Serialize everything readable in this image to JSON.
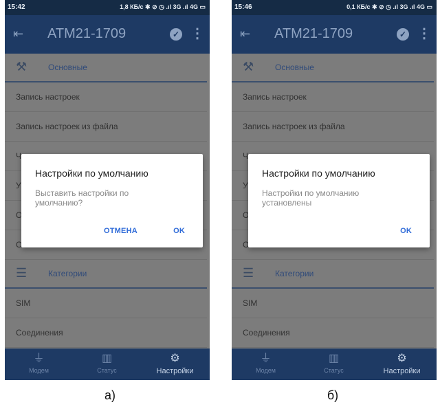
{
  "colors": {
    "statusbar": "#152b45",
    "appbar": "#1e3a64",
    "bottomnav": "#1e3a64",
    "dimmed_background": "#7c7c7c",
    "dialog_button": "#2f6bd8"
  },
  "screens": [
    {
      "caption": "а)",
      "status": {
        "time": "15:42",
        "icons": "1,8 КБ/с ✱ ⊘ ◷ .ıl 3G .ıl 4G ▭"
      },
      "appbar": {
        "title": "ATM21-1709",
        "back_icon": "back-arrow-icon",
        "check_icon": "check-circle-icon",
        "more_icon": "more-vert-icon"
      },
      "sections": [
        {
          "header": "Основные",
          "icon": "tools-icon",
          "items": [
            "Запись настроек",
            "Запись настроек из файла",
            "Чтение настроек",
            "У",
            "О",
            "О"
          ]
        },
        {
          "header": "Категории",
          "icon": "sliders-icon",
          "items": [
            "SIM",
            "Соединения"
          ]
        }
      ],
      "bottom_nav": [
        {
          "label": "Модем",
          "icon": "modem-icon",
          "active": false
        },
        {
          "label": "Статус",
          "icon": "status-icon",
          "active": false
        },
        {
          "label": "Настройки",
          "icon": "gear-icon",
          "active": true
        }
      ],
      "dialog": {
        "title": "Настройки по умолчанию",
        "message": "Выставить настройки по умолчанию?",
        "cancel_label": "ОТМЕНА",
        "ok_label": "OK"
      }
    },
    {
      "caption": "б)",
      "status": {
        "time": "15:46",
        "icons": "0,1 КБ/с ✱ ⊘ ◷ .ıl 3G .ıl 4G ▭"
      },
      "appbar": {
        "title": "ATM21-1709",
        "back_icon": "back-arrow-icon",
        "check_icon": "check-circle-icon",
        "more_icon": "more-vert-icon"
      },
      "sections": [
        {
          "header": "Основные",
          "icon": "tools-icon",
          "items": [
            "Запись настроек",
            "Запись настроек из файла",
            "Чтение настроек",
            "У",
            "О",
            "О"
          ]
        },
        {
          "header": "Категории",
          "icon": "sliders-icon",
          "items": [
            "SIM",
            "Соединения"
          ]
        }
      ],
      "bottom_nav": [
        {
          "label": "Модем",
          "icon": "modem-icon",
          "active": false
        },
        {
          "label": "Статус",
          "icon": "status-icon",
          "active": false
        },
        {
          "label": "Настройки",
          "icon": "gear-icon",
          "active": true
        }
      ],
      "dialog": {
        "title": "Настройки по умолчанию",
        "message": "Настройки по умолчанию установлены",
        "ok_label": "OK"
      }
    }
  ]
}
